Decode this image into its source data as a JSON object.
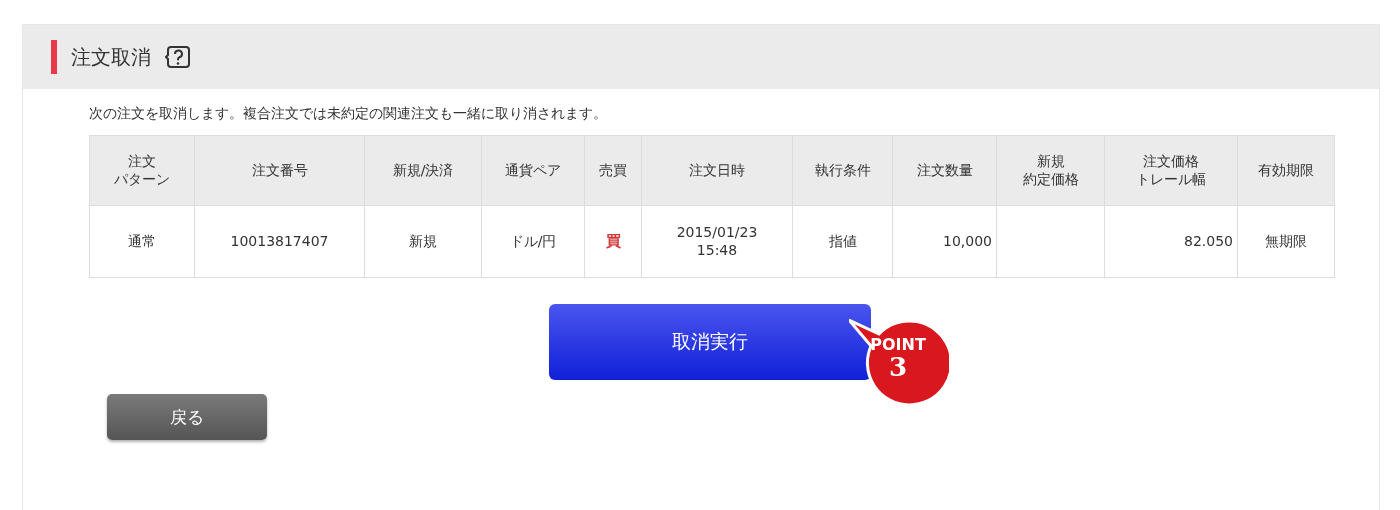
{
  "panel": {
    "title": "注文取消",
    "message": "次の注文を取消します。複合注文では未約定の関連注文も一緒に取り消されます。"
  },
  "table": {
    "columns": [
      {
        "lines": [
          "注文",
          "パターン"
        ]
      },
      {
        "lines": [
          "注文番号"
        ]
      },
      {
        "lines": [
          "新規/決済"
        ]
      },
      {
        "lines": [
          "通貨ペア"
        ]
      },
      {
        "lines": [
          "売買"
        ]
      },
      {
        "lines": [
          "注文日時"
        ]
      },
      {
        "lines": [
          "執行条件"
        ]
      },
      {
        "lines": [
          "注文数量"
        ]
      },
      {
        "lines": [
          "新規",
          "約定価格"
        ]
      },
      {
        "lines": [
          "注文価格",
          "トレール幅"
        ]
      },
      {
        "lines": [
          "有効期限"
        ]
      }
    ],
    "rows": [
      {
        "cells": [
          {
            "text": "通常"
          },
          {
            "text": "10013817407"
          },
          {
            "text": "新規"
          },
          {
            "text": "ドル/円"
          },
          {
            "text": "買",
            "color": "#d03a3a"
          },
          {
            "text": "2015/01/23\n15:48"
          },
          {
            "text": "指値"
          },
          {
            "text": "10,000"
          },
          {
            "text": ""
          },
          {
            "text": "82.050"
          },
          {
            "text": "無期限"
          }
        ]
      }
    ]
  },
  "buttons": {
    "execute": "取消実行",
    "back": "戻る"
  },
  "badge": {
    "label": "POINT",
    "number": "3"
  }
}
